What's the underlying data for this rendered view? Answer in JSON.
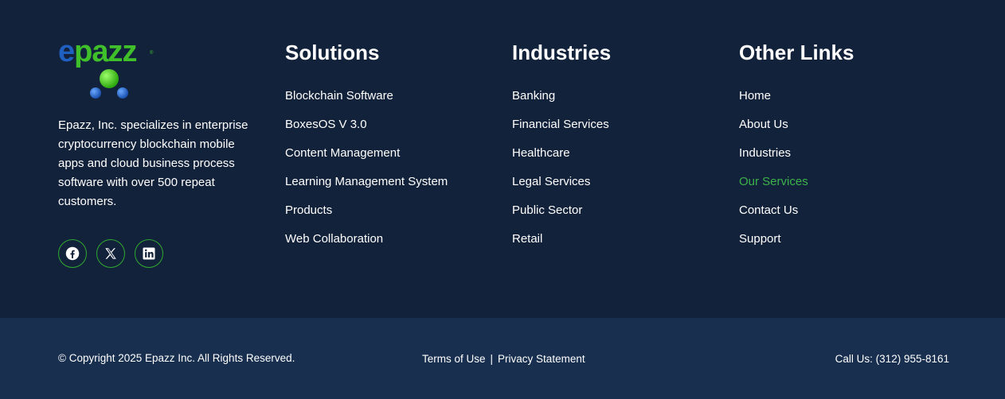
{
  "brand": {
    "logo_text_e": "e",
    "logo_text_rest": "pazz",
    "logo_tm": "®",
    "description": "Epazz, Inc. specializes in enterprise cryptocurrency blockchain mobile apps and cloud business process software with over 500 repeat customers.",
    "social": [
      {
        "name": "facebook-icon"
      },
      {
        "name": "x-icon"
      },
      {
        "name": "linkedin-icon"
      }
    ]
  },
  "solutions": {
    "title": "Solutions",
    "items": [
      "Blockchain Software",
      "BoxesOS V 3.0",
      "Content Management",
      "Learning Management System",
      "Products",
      "Web Collaboration"
    ]
  },
  "industries": {
    "title": "Industries",
    "items": [
      "Banking",
      "Financial Services",
      "Healthcare",
      "Legal Services",
      "Public Sector",
      "Retail"
    ]
  },
  "other_links": {
    "title": "Other Links",
    "items": [
      "Home",
      "About Us",
      "Industries",
      "Our Services",
      "Contact Us",
      "Support"
    ],
    "active_index": 3
  },
  "bottom": {
    "copyright": "© Copyright 2025 Epazz Inc. All Rights Reserved.",
    "terms": "Terms of Use",
    "separator": "|",
    "privacy": "Privacy Statement",
    "call": "Call Us: (312) 955-8161"
  },
  "colors": {
    "main_bg": "#13223b",
    "bottom_bg": "#182f4f",
    "accent_green": "#3bb34a",
    "logo_blue": "#1e5fbf"
  }
}
